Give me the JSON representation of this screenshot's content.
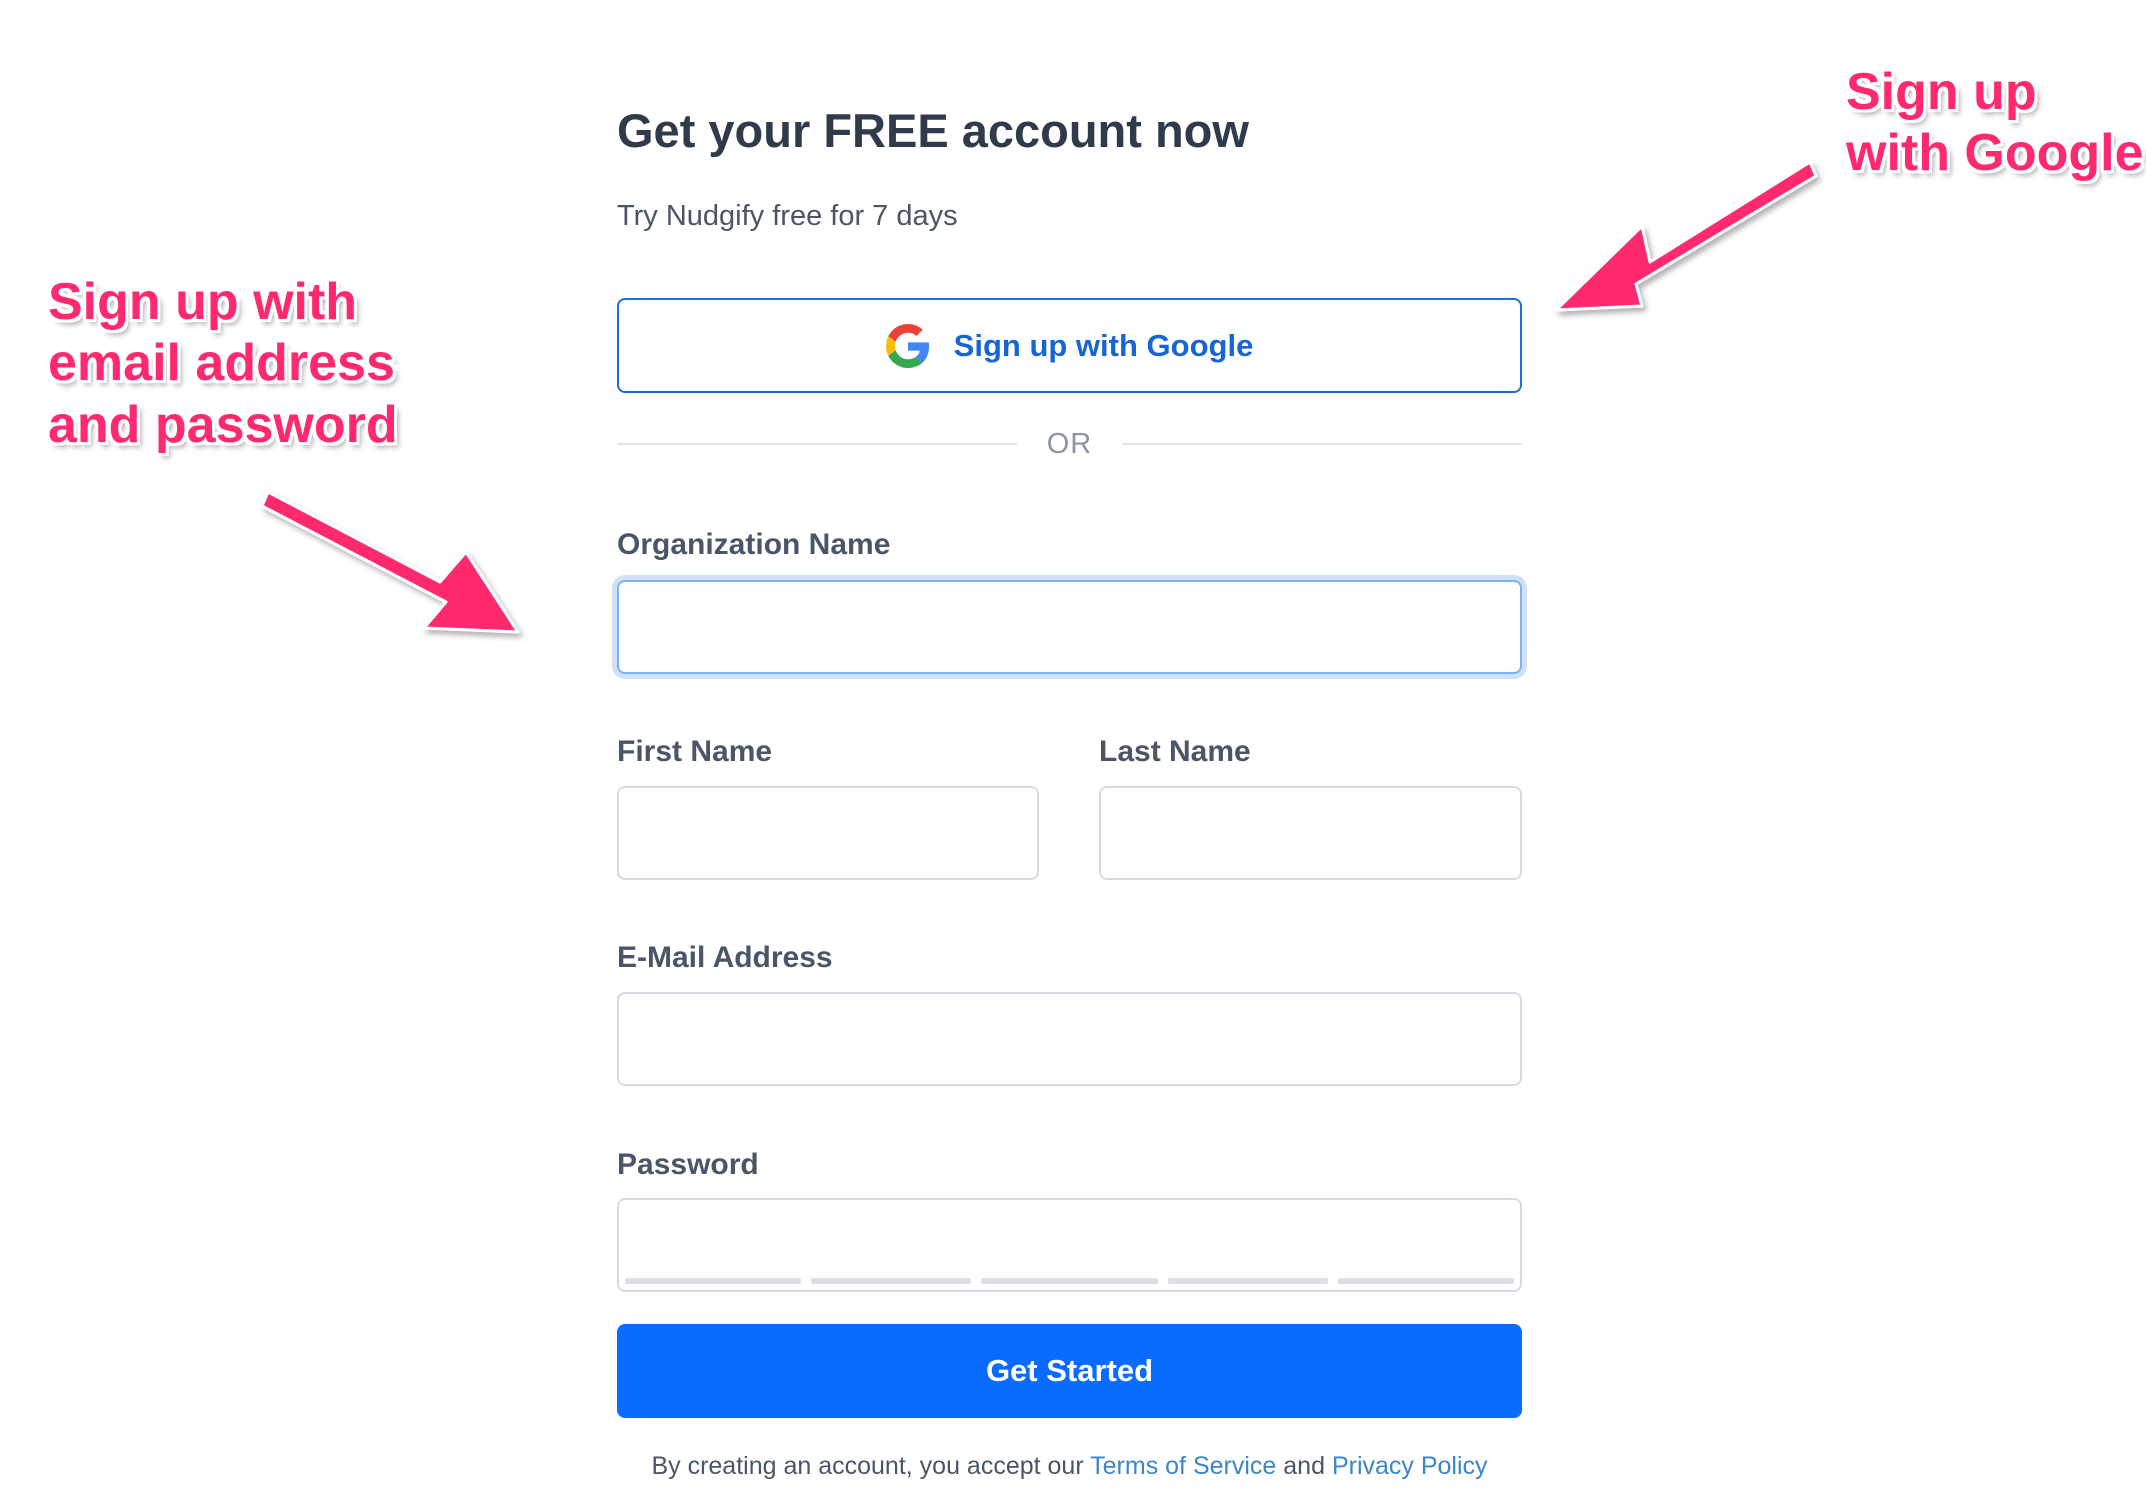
{
  "header": {
    "title": "Get your FREE account now",
    "subtitle": "Try Nudgify free for 7 days"
  },
  "google_button": {
    "label": "Sign up with Google",
    "icon": "google-g-icon"
  },
  "divider": {
    "text": "OR"
  },
  "fields": {
    "organization": {
      "label": "Organization Name",
      "value": "",
      "placeholder": ""
    },
    "first_name": {
      "label": "First Name",
      "value": "",
      "placeholder": ""
    },
    "last_name": {
      "label": "Last Name",
      "value": "",
      "placeholder": ""
    },
    "email": {
      "label": "E-Mail Address",
      "value": "",
      "placeholder": ""
    },
    "password": {
      "label": "Password",
      "value": "",
      "placeholder": "",
      "strength_segments": 5,
      "strength_filled": 0
    }
  },
  "submit": {
    "label": "Get Started",
    "color": "#0a6cff"
  },
  "terms": {
    "prefix": "By creating an account, you accept our ",
    "tos_link": "Terms of Service",
    "middle": " and ",
    "privacy_link": "Privacy Policy"
  },
  "annotations": {
    "google_callout": [
      "Sign up",
      "with Google"
    ],
    "email_callout": [
      "Sign up with",
      "email address",
      "and password"
    ],
    "color": "#ff2a6d"
  }
}
